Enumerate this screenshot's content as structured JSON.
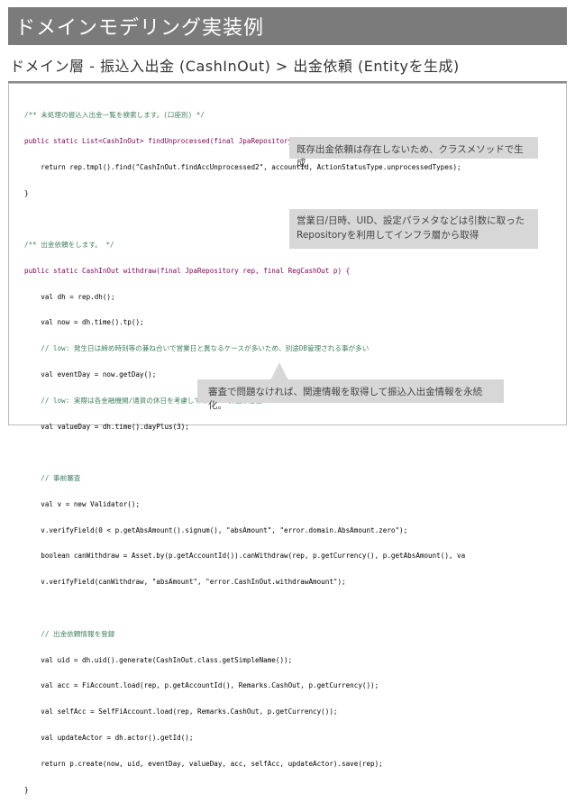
{
  "slide": {
    "title": "ドメインモデリング実装例",
    "subtitle": "ドメイン層 - 振込入出金 (CashInOut) > 出金依頼 (Entityを生成)"
  },
  "code_lines": [
    "/** 未処理の振込入出金一覧を検索します。(口座別) */",
    "public static List<CashInOut> findUnprocessed(final JpaRepository rep, String accountId) {",
    "    return rep.tmpl().find(\"CashInOut.findAccUnprocessed2\", accountId, ActionStatusType.unprocessedTypes);",
    "}",
    "",
    "/** 出金依頼をします。 */",
    "public static CashInOut withdraw(final JpaRepository rep, final RegCashOut p) {",
    "    val dh = rep.dh();",
    "    val now = dh.time().tp();",
    "    // low: 発生日は締め時刻等の兼ね合いで営業日と異なるケースが多いため、別途DB管理される事が多い",
    "    val eventDay = now.getDay();",
    "    // low: 実際は各金融機関/通貨の休日を考慮しての T+N 算出が必要",
    "    val valueDay = dh.time().dayPlus(3);",
    "",
    "    // 事前審査",
    "    val v = new Validator();",
    "    v.verifyField(0 < p.getAbsAmount().signum(), \"absAmount\", \"error.domain.AbsAmount.zero\");",
    "    boolean canWithdraw = Asset.by(p.getAccountId()).canWithdraw(rep, p.getCurrency(), p.getAbsAmount(), va",
    "    v.verifyField(canWithdraw, \"absAmount\", \"error.CashInOut.withdrawAmount\");",
    "",
    "    // 出金依頼情報を登録",
    "    val uid = dh.uid().generate(CashInOut.class.getSimpleName());",
    "    val acc = FiAccount.load(rep, p.getAccountId(), Remarks.CashOut, p.getCurrency());",
    "    val selfAcc = SelfFiAccount.load(rep, Remarks.CashOut, p.getCurrency());",
    "    val updateActor = dh.actor().getId();",
    "    return p.create(now, uid, eventDay, valueDay, acc, selfAcc, updateActor).save(rep);",
    "}"
  ],
  "callouts": {
    "c1": "既存出金依頼は存在しないため、クラスメソッドで生成",
    "c2_line1": "営業日/日時、UID、設定パラメタなどは引数に取った",
    "c2_line2": "Repositoryを利用してインフラ層から取得",
    "c3": "審査で問題なければ、関連情報を取得して振込入出金情報を永続化。"
  }
}
